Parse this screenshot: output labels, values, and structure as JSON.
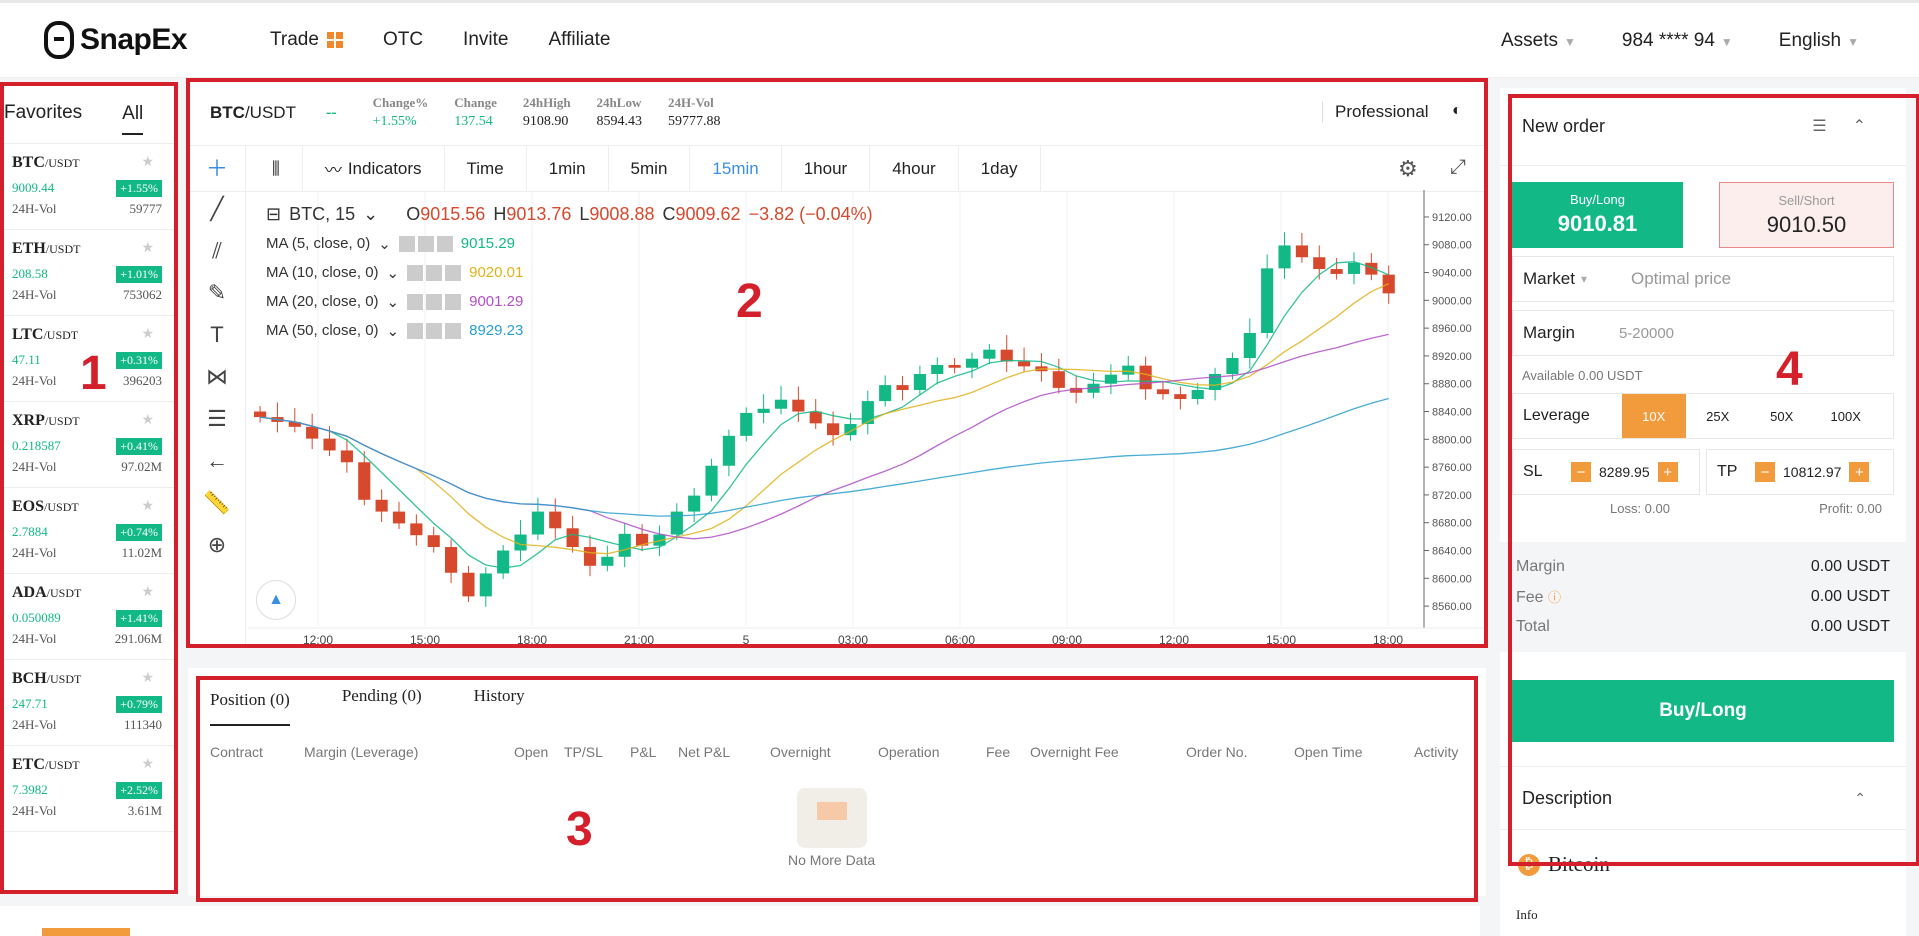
{
  "brand": {
    "name": "SnapEx"
  },
  "nav": {
    "items": [
      "Trade",
      "OTC",
      "Invite",
      "Affiliate"
    ],
    "assets": "Assets",
    "account": "984 **** 94",
    "language": "English"
  },
  "markets": {
    "tabs": [
      "Favorites",
      "All"
    ],
    "coins": [
      {
        "symbol": "BTC",
        "quote": "/USDT",
        "price": "9009.44",
        "change": "+1.55%",
        "vol_label": "24H-Vol",
        "vol": "59777"
      },
      {
        "symbol": "ETH",
        "quote": "/USDT",
        "price": "208.58",
        "change": "+1.01%",
        "vol_label": "24H-Vol",
        "vol": "753062"
      },
      {
        "symbol": "LTC",
        "quote": "/USDT",
        "price": "47.11",
        "change": "+0.31%",
        "vol_label": "24H-Vol",
        "vol": "396203"
      },
      {
        "symbol": "XRP",
        "quote": "/USDT",
        "price": "0.218587",
        "change": "+0.41%",
        "vol_label": "24H-Vol",
        "vol": "97.02M"
      },
      {
        "symbol": "EOS",
        "quote": "/USDT",
        "price": "2.7884",
        "change": "+0.74%",
        "vol_label": "24H-Vol",
        "vol": "11.02M"
      },
      {
        "symbol": "ADA",
        "quote": "/USDT",
        "price": "0.050089",
        "change": "+1.41%",
        "vol_label": "24H-Vol",
        "vol": "291.06M"
      },
      {
        "symbol": "BCH",
        "quote": "/USDT",
        "price": "247.71",
        "change": "+0.79%",
        "vol_label": "24H-Vol",
        "vol": "111340"
      },
      {
        "symbol": "ETC",
        "quote": "/USDT",
        "price": "7.3982",
        "change": "+2.52%",
        "vol_label": "24H-Vol",
        "vol": "3.61M"
      }
    ]
  },
  "ticker": {
    "pair_base": "BTC",
    "pair_quote": "/USDT",
    "dash": "--",
    "stats": [
      {
        "label": "Change%",
        "value": "+1.55%"
      },
      {
        "label": "Change",
        "value": "137.54"
      },
      {
        "label": "24hHigh",
        "value": "9108.90"
      },
      {
        "label": "24hLow",
        "value": "8594.43"
      },
      {
        "label": "24H-Vol",
        "value": "59777.88"
      }
    ],
    "mode": "Professional"
  },
  "chart_toolbar": {
    "indicators": "Indicators",
    "intervals": [
      "Time",
      "1min",
      "5min",
      "15min",
      "1hour",
      "4hour",
      "1day"
    ],
    "active_interval": "15min"
  },
  "chart_legend": {
    "symbol": "BTC, 15",
    "o_label": "O",
    "o": "9015.56",
    "h_label": "H",
    "h": "9013.76",
    "l_label": "L",
    "l": "9008.88",
    "c_label": "C",
    "c": "9009.62",
    "delta": "−3.82 (−0.04%)",
    "mas": [
      {
        "label": "MA (5, close, 0)",
        "value": "9015.29",
        "color": "#12b886"
      },
      {
        "label": "MA (10, close, 0)",
        "value": "9020.01",
        "color": "#e0b21a"
      },
      {
        "label": "MA (20, close, 0)",
        "value": "9001.29",
        "color": "#b04fc7"
      },
      {
        "label": "MA (50, close, 0)",
        "value": "8929.23",
        "color": "#2a9fcf"
      }
    ]
  },
  "chart_axis": {
    "y_ticks": [
      "9120.00",
      "9080.00",
      "9040.00",
      "9000.00",
      "8960.00",
      "8920.00",
      "8880.00",
      "8840.00",
      "8800.00",
      "8760.00",
      "8720.00",
      "8680.00",
      "8640.00",
      "8600.00",
      "8560.00"
    ],
    "x_ticks": [
      "12:00",
      "15:00",
      "18:00",
      "21:00",
      "5",
      "03:00",
      "06:00",
      "09:00",
      "12:00",
      "15:00",
      "18:00"
    ]
  },
  "orders": {
    "tabs": [
      "Position (0)",
      "Pending (0)",
      "History"
    ],
    "columns": [
      "Contract",
      "Margin (Leverage)",
      "Open",
      "TP/SL",
      "P&L",
      "Net P&L",
      "Overnight",
      "Operation",
      "Fee",
      "Overnight Fee",
      "Order No.",
      "Open Time",
      "Activity"
    ],
    "empty": "No More Data"
  },
  "order_form": {
    "title": "New order",
    "buy_label": "Buy/Long",
    "buy_price": "9010.81",
    "sell_label": "Sell/Short",
    "sell_price": "9010.50",
    "market": "Market",
    "market_placeholder": "Optimal price",
    "margin": "Margin",
    "margin_placeholder": "5-20000",
    "available": "Available 0.00 USDT",
    "leverage": "Leverage",
    "leverage_options": [
      "10X",
      "25X",
      "50X",
      "100X"
    ],
    "sl_label": "SL",
    "sl_value": "8289.95",
    "tp_label": "TP",
    "tp_value": "10812.97",
    "loss": "Loss:  0.00",
    "profit": "Profit:  0.00",
    "summary": [
      {
        "label": "Margin",
        "value": "0.00 USDT"
      },
      {
        "label": "Fee",
        "value": "0.00 USDT"
      },
      {
        "label": "Total",
        "value": "0.00 USDT"
      }
    ],
    "submit": "Buy/Long",
    "description": "Description",
    "coin_name": "Bitcoin",
    "info": "Info"
  },
  "annotations": [
    "1",
    "2",
    "3",
    "4"
  ],
  "colors": {
    "green": "#12b886",
    "red": "#d6492d",
    "orange": "#f19b3d",
    "annotation": "#d3202a"
  },
  "chart_data": {
    "type": "candlestick",
    "ylim": [
      8540,
      9130
    ],
    "close_path": [
      8840,
      8830,
      8820,
      8800,
      8780,
      8760,
      8720,
      8700,
      8680,
      8660,
      8640,
      8600,
      8580,
      8610,
      8640,
      8660,
      8690,
      8680,
      8650,
      8620,
      8630,
      8660,
      8640,
      8670,
      8700,
      8720,
      8760,
      8800,
      8830,
      8850,
      8860,
      8840,
      8820,
      8800,
      8830,
      8860,
      8880,
      8870,
      8890,
      8900,
      8910,
      8920,
      8930,
      8910,
      8900,
      8890,
      8880,
      8870,
      8880,
      8890,
      8900,
      8880,
      8870,
      8860,
      8870,
      8890,
      8910,
      8960,
      9050,
      9080,
      9060,
      9040,
      9030,
      9060,
      9040,
      9010
    ]
  }
}
